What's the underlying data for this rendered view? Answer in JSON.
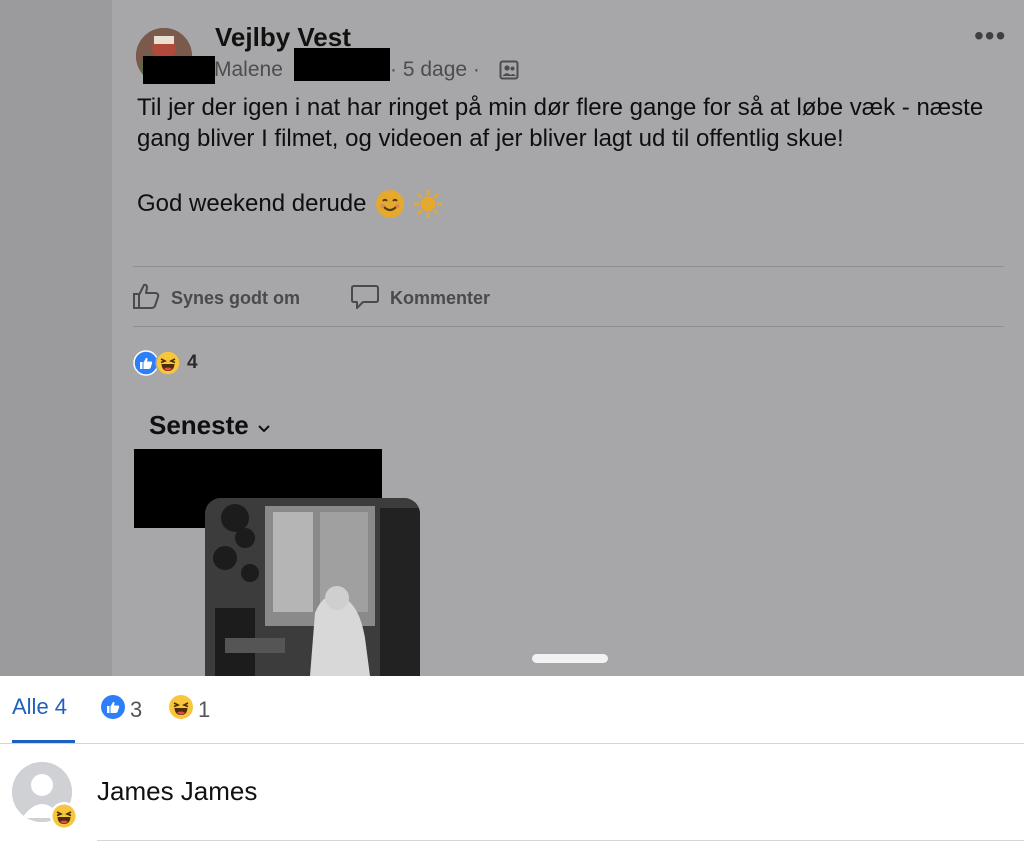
{
  "post": {
    "group_name": "Vejlby Vest",
    "author_visible": "Malene",
    "time": "· 5 dage ·",
    "group_icon": "group-visibility-icon",
    "more_icon": "more-options-icon",
    "text_line1": "Til jer der igen i nat har ringet på min dør flere gange for så at løbe væk - næste gang bliver I filmet, og videoen af jer bliver lagt ud til offentlig skue!",
    "text_line2": "God weekend derude",
    "emojis": [
      "smiling-face-icon",
      "sun-icon"
    ]
  },
  "actions": {
    "like_label": "Synes godt om",
    "comment_label": "Kommenter"
  },
  "reactions": {
    "icons": [
      "like-reaction-icon",
      "haha-reaction-icon"
    ],
    "count": "4"
  },
  "comments": {
    "sort_label": "Seneste"
  },
  "reaction_sheet": {
    "tabs": [
      {
        "label": "Alle 4",
        "selected": true
      },
      {
        "icon": "like-reaction-icon",
        "count": "3"
      },
      {
        "icon": "haha-reaction-icon",
        "count": "1"
      }
    ],
    "people": [
      {
        "name": "James James",
        "reaction": "haha-reaction-icon"
      }
    ]
  },
  "colors": {
    "accent": "#1f5fbf",
    "like_blue": "#2d7ff9",
    "haha_yellow": "#f7c63d"
  }
}
